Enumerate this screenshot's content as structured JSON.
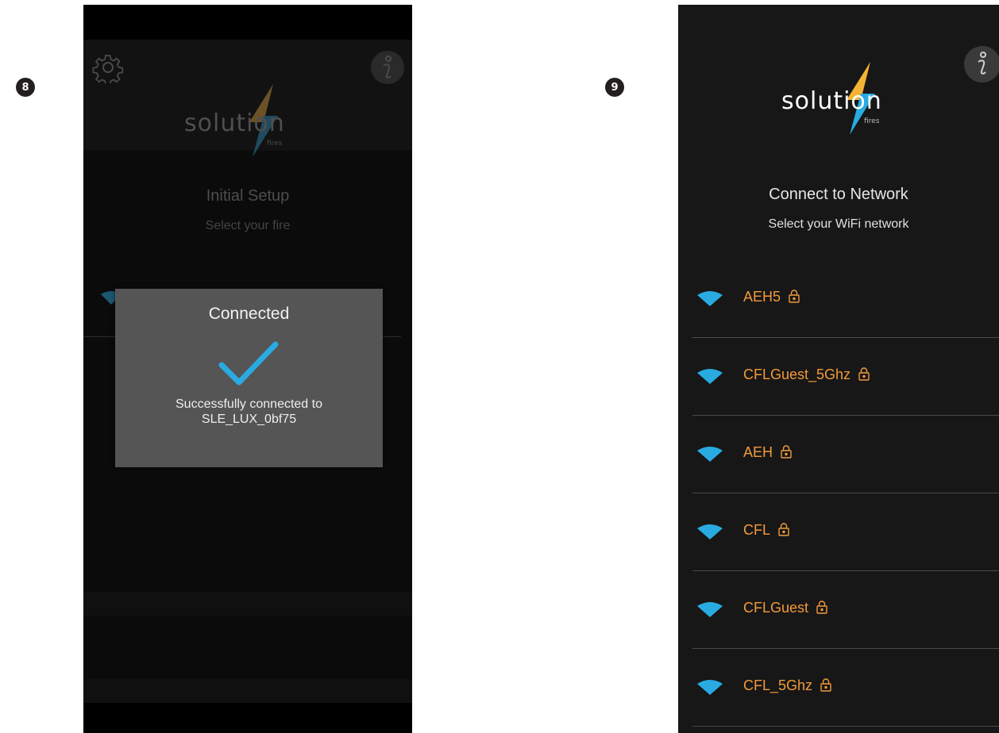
{
  "steps": {
    "left": "8",
    "right": "9"
  },
  "brand": {
    "name": "solution",
    "sub": "fires"
  },
  "colors": {
    "accent_wifi": "#29abe2",
    "network_name": "#f29a3b",
    "bolt_gold": "#f5b335",
    "bolt_blue": "#29abe2"
  },
  "left_screen": {
    "title": "Initial Setup",
    "subtitle": "Select your fire",
    "icons": {
      "settings": "gear-icon",
      "info": "info-icon"
    },
    "dialog": {
      "title": "Connected",
      "icon": "checkmark-icon",
      "message_line1": "Successfully connected to",
      "message_line2": "SLE_LUX_0bf75"
    }
  },
  "right_screen": {
    "title": "Connect to Network",
    "subtitle": "Select your WiFi network",
    "icons": {
      "info": "info-icon"
    },
    "networks": [
      {
        "name": "AEH5",
        "secured": true
      },
      {
        "name": "CFLGuest_5Ghz",
        "secured": true
      },
      {
        "name": "AEH",
        "secured": true
      },
      {
        "name": "CFL",
        "secured": true
      },
      {
        "name": "CFLGuest",
        "secured": true
      },
      {
        "name": "CFL_5Ghz",
        "secured": true
      }
    ]
  }
}
